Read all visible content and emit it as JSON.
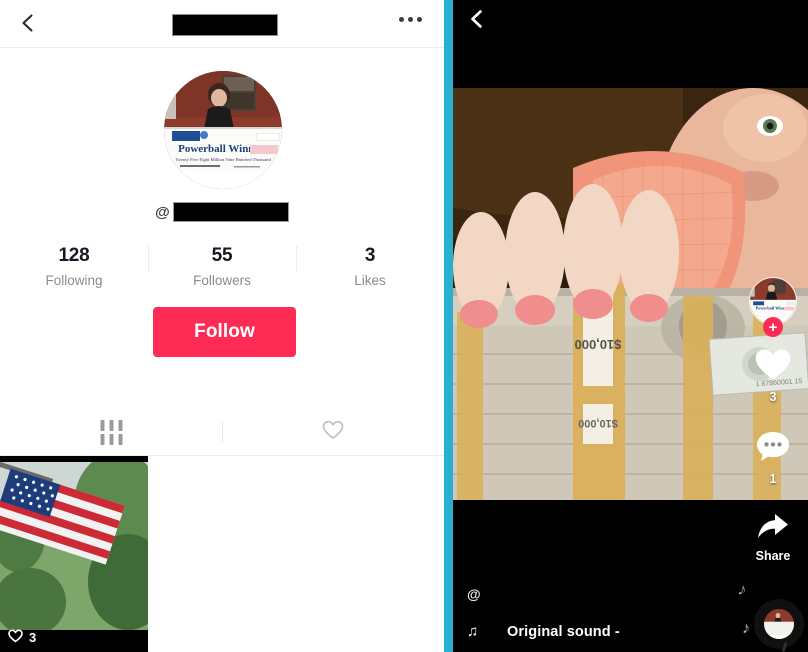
{
  "colors": {
    "accent_red": "#fe2c55",
    "divider_teal": "#29b0d0",
    "panel_bg": "#ffffff",
    "video_bg": "#000000",
    "stat_label": "#8a8b91",
    "text_primary": "#161823"
  },
  "profile": {
    "header": {
      "back_icon": "chevron-left-icon",
      "title_redacted": true,
      "menu_icon": "ellipsis-horizontal-icon"
    },
    "avatar": {
      "icon": "profile-avatar-image",
      "description": "Powerball Winner! oversized lottery check held by a woman"
    },
    "handle": {
      "at_symbol": "@",
      "username_redacted": true
    },
    "stats": [
      {
        "count": "128",
        "label": "Following"
      },
      {
        "count": "55",
        "label": "Followers"
      },
      {
        "count": "3",
        "label": "Likes"
      }
    ],
    "follow_button": "Follow",
    "tabs": [
      {
        "name": "posts",
        "icon": "grid-icon",
        "active": true
      },
      {
        "name": "liked",
        "icon": "heart-outline-icon",
        "active": false
      }
    ],
    "posts": [
      {
        "like_count": "3",
        "icon": "heart-icon",
        "description": "American flag waving by green trees"
      }
    ]
  },
  "video": {
    "back_icon": "chevron-left-icon",
    "content_description": "Person in orange shirt with hands over banded $10,000 cash bundles",
    "rail": {
      "avatar_icon": "creator-avatar",
      "follow_badge": "+",
      "like": {
        "icon": "heart-filled-icon",
        "count": "3"
      },
      "comment": {
        "icon": "comment-bubble-icon",
        "count": "1"
      },
      "share": {
        "icon": "share-arrow-icon",
        "label": "Share"
      }
    },
    "caption": {
      "at_symbol": "@",
      "username_redacted": true,
      "music_icon": "music-note-icon",
      "song": "Original sound -",
      "disc_icon": "vinyl-record-icon"
    }
  }
}
